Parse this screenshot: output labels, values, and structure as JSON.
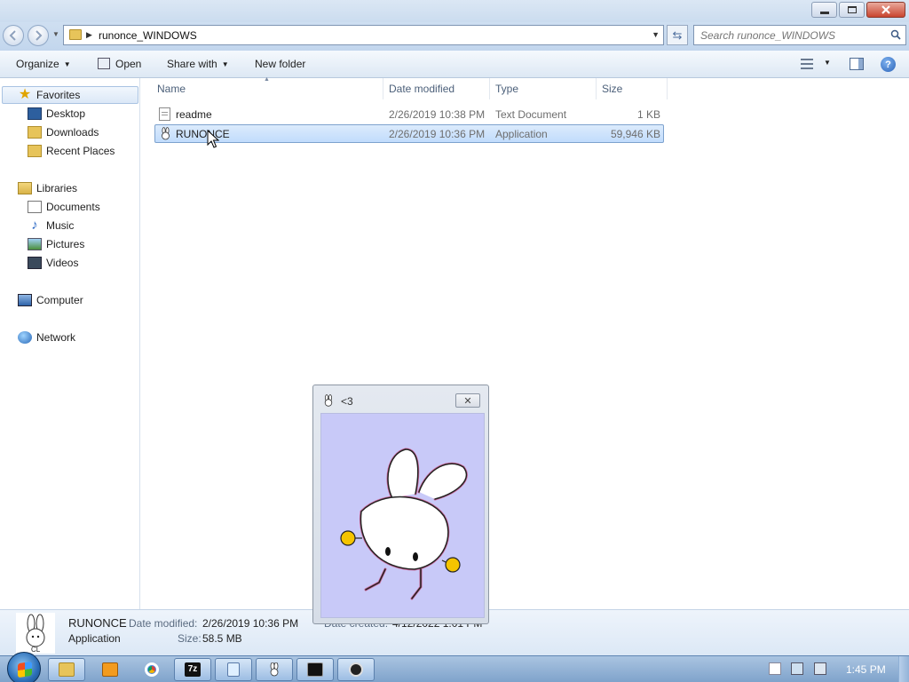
{
  "window": {
    "controls": [
      "minimize",
      "maximize",
      "close"
    ]
  },
  "address": {
    "crumb": "runonce_WINDOWS",
    "search_placeholder": "Search runonce_WINDOWS"
  },
  "toolbar": {
    "organize": "Organize",
    "open": "Open",
    "share_with": "Share with",
    "new_folder": "New folder"
  },
  "nav": {
    "favorites": "Favorites",
    "desktop": "Desktop",
    "downloads": "Downloads",
    "recent_places": "Recent Places",
    "libraries": "Libraries",
    "documents": "Documents",
    "music": "Music",
    "pictures": "Pictures",
    "videos": "Videos",
    "computer": "Computer",
    "network": "Network"
  },
  "columns": {
    "name": "Name",
    "date_modified": "Date modified",
    "type": "Type",
    "size": "Size"
  },
  "files": [
    {
      "name": "readme",
      "date": "2/26/2019 10:38 PM",
      "type": "Text Document",
      "size": "1 KB",
      "selected": false
    },
    {
      "name": "RUNONCE",
      "date": "2/26/2019 10:36 PM",
      "type": "Application",
      "size": "59,946 KB",
      "selected": true
    }
  ],
  "details": {
    "name": "RUNONCE",
    "type": "Application",
    "date_modified_label": "Date modified:",
    "date_modified": "2/26/2019 10:36 PM",
    "size_label": "Size:",
    "size": "58.5 MB",
    "date_created_label": "Date created:",
    "date_created": "4/12/2022 1:01 PM",
    "thumb_caption": "CL"
  },
  "popup": {
    "title": "<3"
  },
  "taskbar": {
    "clock": "1:45 PM"
  },
  "colors": {
    "selection": "#c1dcfc",
    "popup_canvas": "#c8c9f8",
    "taskbar": "#7fa3cb"
  }
}
